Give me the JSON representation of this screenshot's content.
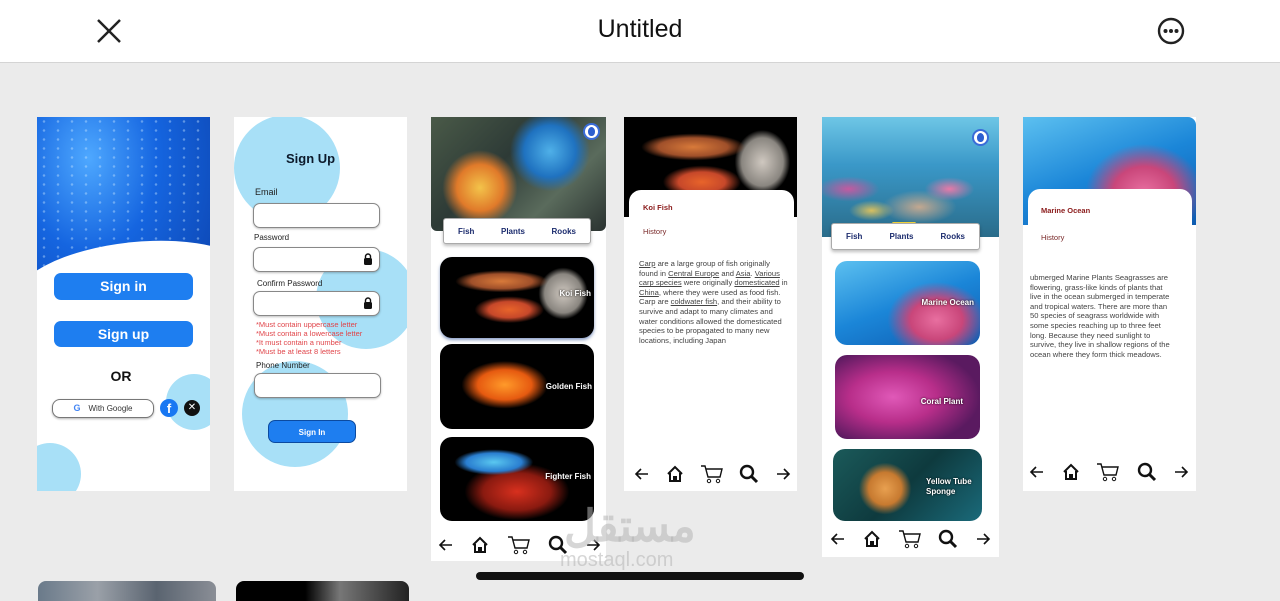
{
  "header": {
    "title": "Untitled",
    "close_icon": "close-icon",
    "more_icon": "more-options-icon"
  },
  "frames": {
    "welcome": {
      "sign_in": "Sign in",
      "sign_up": "Sign up",
      "or": "OR",
      "google": "With Google",
      "google_glyph": "G",
      "facebook_glyph": "f",
      "x_glyph": "✕"
    },
    "signup": {
      "title": "Sign Up",
      "email_label": "Email",
      "email_value": "",
      "password_label": "Password",
      "password_value": "",
      "confirm_label": "Confirm Password",
      "confirm_value": "",
      "rules": [
        "*Must contain uppercase letter",
        "*Must contain a lowercase letter",
        "*It must contain a number",
        "*Must be at least 8 letters"
      ],
      "phone_label": "Phone Number",
      "phone_value": "",
      "submit": "Sign In"
    },
    "fish_list": {
      "tabs": [
        "Fish",
        "Plants",
        "Rooks"
      ],
      "cards": [
        "Koi Fish",
        "Golden  Fish",
        "Fighter Fish"
      ]
    },
    "koi_detail": {
      "title": "Koi Fish",
      "subtitle": "History",
      "text_parts": [
        {
          "t": "Carp",
          "u": true
        },
        {
          "t": " are a large group of fish originally found in ",
          "u": false
        },
        {
          "t": "Central Europe",
          "u": true
        },
        {
          "t": " and ",
          "u": false
        },
        {
          "t": "Asia",
          "u": true
        },
        {
          "t": ". ",
          "u": false
        },
        {
          "t": "Various carp species",
          "u": true
        },
        {
          "t": " were originally ",
          "u": false
        },
        {
          "t": "domesticated",
          "u": true
        },
        {
          "t": " in ",
          "u": false
        },
        {
          "t": "China",
          "u": true
        },
        {
          "t": ", where they were used as food fish. Carp are ",
          "u": false
        },
        {
          "t": "coldwater fish",
          "u": true
        },
        {
          "t": ", and their ability to survive and adapt to many climates and water conditions allowed the domesticated species to be propagated to many new locations, including Japan",
          "u": false
        }
      ]
    },
    "plant_list": {
      "tabs": [
        "Fish",
        "Plants",
        "Rooks"
      ],
      "active_tab": "Plants",
      "cards": [
        "Marine Ocean",
        "Coral Plant",
        "Yellow Tube Sponge"
      ]
    },
    "marine_detail": {
      "title": "Marine Ocean",
      "subtitle": "History",
      "text": "ubmerged Marine Plants Seagrasses are flowering, grass-like kinds of plants that live in the ocean submerged in temperate and tropical waters. There are more than 50 species of seagrass worldwide with some species reaching up to three feet long. Because they need sunlight to survive, they live in shallow regions of the ocean where they form thick meadows."
    }
  },
  "nav_icons": [
    "back-arrow-icon",
    "home-icon",
    "cart-icon",
    "search-icon",
    "forward-arrow-icon"
  ],
  "watermark": {
    "arabic": "مستقل",
    "latin": "mostaql.com"
  },
  "colors": {
    "primary_blue": "#1e7ef0",
    "light_blue_circle": "#a8e0f7",
    "error_red": "#e0454a",
    "detail_title": "#8a1a1a",
    "tab_text": "#1c2c6e"
  }
}
